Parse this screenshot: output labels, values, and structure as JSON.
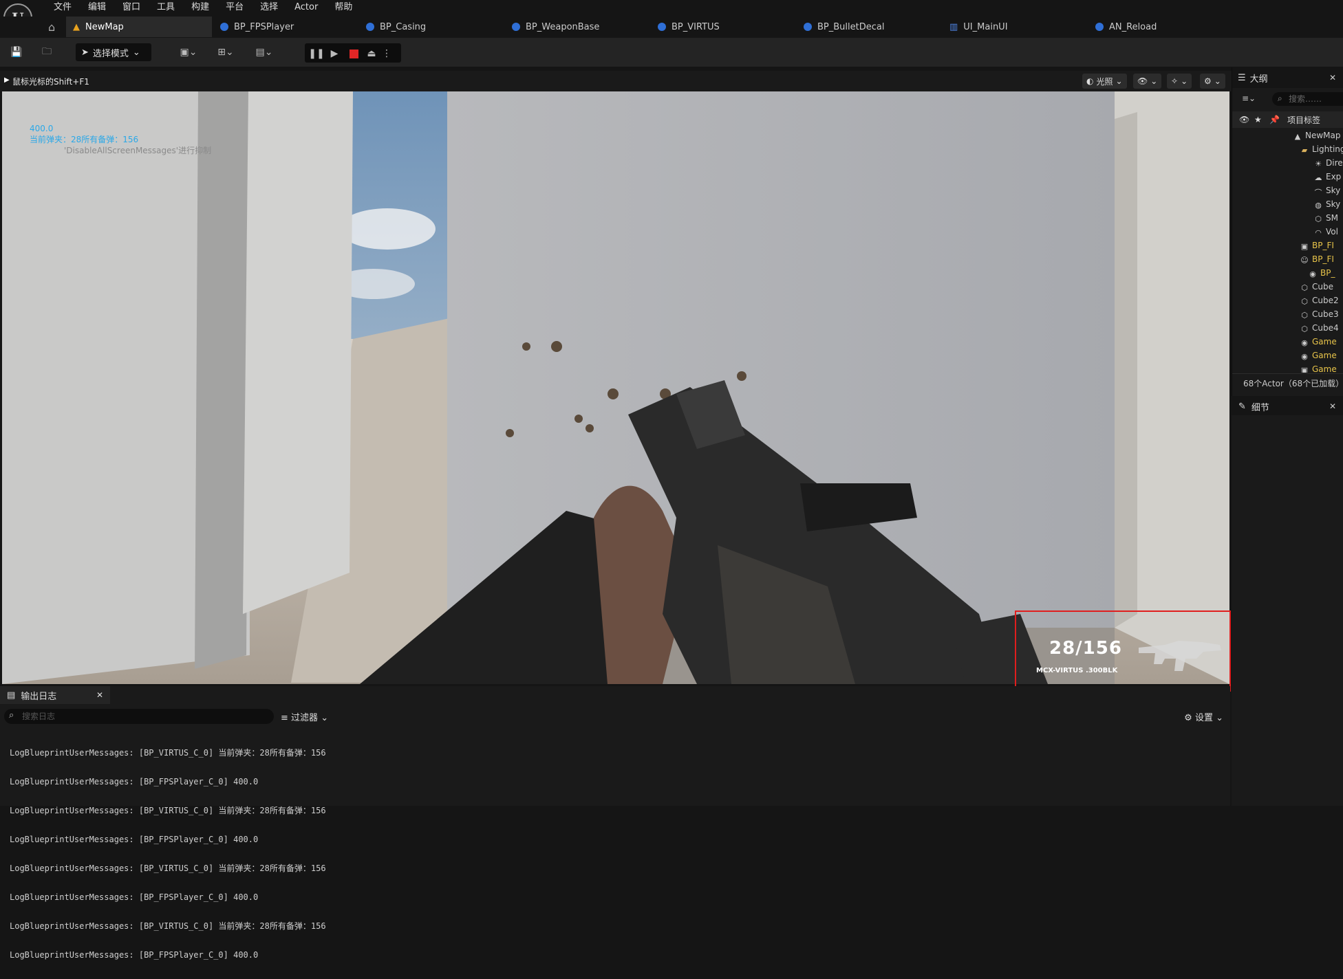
{
  "menu": [
    "文件",
    "编辑",
    "窗口",
    "工具",
    "构建",
    "平台",
    "选择",
    "Actor",
    "帮助"
  ],
  "tabs": [
    {
      "label": "NewMap",
      "active": true
    },
    {
      "label": "BP_FPSPlayer"
    },
    {
      "label": "BP_Casing"
    },
    {
      "label": "BP_WeaponBase"
    },
    {
      "label": "BP_VIRTUS"
    },
    {
      "label": "BP_BulletDecal"
    },
    {
      "label": "UI_MainUI"
    },
    {
      "label": "AN_Reload"
    }
  ],
  "toolbar": {
    "mode_label": "选择模式"
  },
  "viewport": {
    "hint": "鼠标光标的Shift+F1",
    "lighting_label": "光照",
    "debug": {
      "line1": "400.0",
      "line2": "当前弹夹：28所有备弹：156",
      "line3": "'DisableAllScreenMessages'进行抑制"
    },
    "hud": {
      "ammo": "28/156",
      "weapon_name": "MCX-VIRTUS .300BLK"
    }
  },
  "outliner": {
    "title": "大纲",
    "search_placeholder": "搜索……",
    "column_label": "项目标签",
    "rows": [
      {
        "label": "NewMap",
        "gold": false
      },
      {
        "label": "Lighting",
        "gold": false
      },
      {
        "label": "Dire",
        "gold": false
      },
      {
        "label": "Exp",
        "gold": false
      },
      {
        "label": "Sky",
        "gold": false
      },
      {
        "label": "Sky",
        "gold": false
      },
      {
        "label": "SM",
        "gold": false
      },
      {
        "label": "Vol",
        "gold": false
      },
      {
        "label": "BP_FI",
        "gold": true
      },
      {
        "label": "BP_FI",
        "gold": true
      },
      {
        "label": "BP_",
        "gold": true
      },
      {
        "label": "Cube",
        "gold": false
      },
      {
        "label": "Cube2",
        "gold": false
      },
      {
        "label": "Cube3",
        "gold": false
      },
      {
        "label": "Cube4",
        "gold": false
      },
      {
        "label": "Game",
        "gold": true
      },
      {
        "label": "Game",
        "gold": true
      },
      {
        "label": "Game",
        "gold": true
      }
    ],
    "count": "68个Actor（68个已加载）"
  },
  "details": {
    "title": "细节"
  },
  "output_log": {
    "tab_label": "输出日志",
    "search_placeholder": "搜索日志",
    "filter_label": "过滤器",
    "settings_label": "设置",
    "lines": [
      "LogBlueprintUserMessages: [BP_VIRTUS_C_0] 当前弹夹：28所有备弹：156",
      "LogBlueprintUserMessages: [BP_FPSPlayer_C_0] 400.0",
      "LogBlueprintUserMessages: [BP_VIRTUS_C_0] 当前弹夹：28所有备弹：156",
      "LogBlueprintUserMessages: [BP_FPSPlayer_C_0] 400.0",
      "LogBlueprintUserMessages: [BP_VIRTUS_C_0] 当前弹夹：28所有备弹：156",
      "LogBlueprintUserMessages: [BP_FPSPlayer_C_0] 400.0",
      "LogBlueprintUserMessages: [BP_VIRTUS_C_0] 当前弹夹：28所有备弹：156",
      "LogBlueprintUserMessages: [BP_FPSPlayer_C_0] 400.0"
    ]
  }
}
